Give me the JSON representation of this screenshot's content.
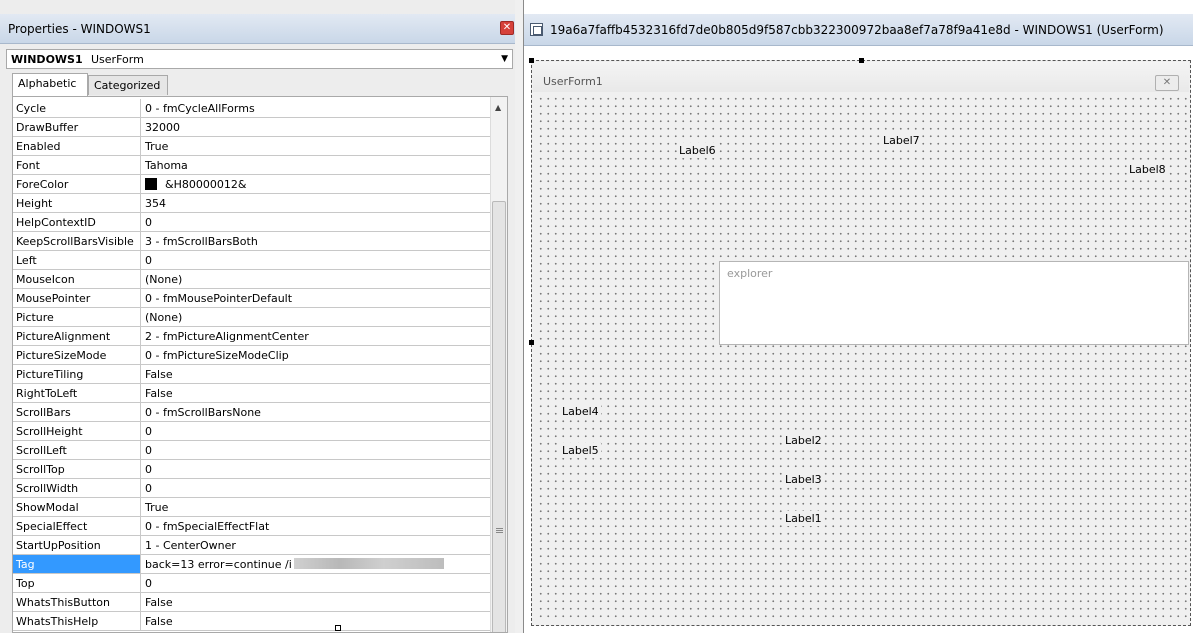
{
  "properties": {
    "title": "Properties - WINDOWS1",
    "close_glyph": "✕",
    "object": {
      "name": "WINDOWS1",
      "type": "UserForm"
    },
    "tabs": [
      "Alphabetic",
      "Categorized"
    ],
    "rows": [
      {
        "name": "Cycle",
        "value": "0 - fmCycleAllForms"
      },
      {
        "name": "DrawBuffer",
        "value": "32000"
      },
      {
        "name": "Enabled",
        "value": "True"
      },
      {
        "name": "Font",
        "value": "Tahoma"
      },
      {
        "name": "ForeColor",
        "value": "&H80000012&"
      },
      {
        "name": "Height",
        "value": "354"
      },
      {
        "name": "HelpContextID",
        "value": "0"
      },
      {
        "name": "KeepScrollBarsVisible",
        "value": "3 - fmScrollBarsBoth"
      },
      {
        "name": "Left",
        "value": "0"
      },
      {
        "name": "MouseIcon",
        "value": "(None)"
      },
      {
        "name": "MousePointer",
        "value": "0 - fmMousePointerDefault"
      },
      {
        "name": "Picture",
        "value": "(None)"
      },
      {
        "name": "PictureAlignment",
        "value": "2 - fmPictureAlignmentCenter"
      },
      {
        "name": "PictureSizeMode",
        "value": "0 - fmPictureSizeModeClip"
      },
      {
        "name": "PictureTiling",
        "value": "False"
      },
      {
        "name": "RightToLeft",
        "value": "False"
      },
      {
        "name": "ScrollBars",
        "value": "0 - fmScrollBarsNone"
      },
      {
        "name": "ScrollHeight",
        "value": "0"
      },
      {
        "name": "ScrollLeft",
        "value": "0"
      },
      {
        "name": "ScrollTop",
        "value": "0"
      },
      {
        "name": "ScrollWidth",
        "value": "0"
      },
      {
        "name": "ShowModal",
        "value": "True"
      },
      {
        "name": "SpecialEffect",
        "value": "0 - fmSpecialEffectFlat"
      },
      {
        "name": "StartUpPosition",
        "value": "1 - CenterOwner"
      },
      {
        "name": "Tag",
        "value": "back=13 error=continue /i",
        "value_end": "msi"
      },
      {
        "name": "Top",
        "value": "0"
      },
      {
        "name": "WhatsThisButton",
        "value": "False"
      },
      {
        "name": "WhatsThisHelp",
        "value": "False"
      }
    ],
    "selected_row": "Tag",
    "forecolor_swatch": "#000000",
    "selection_color": "#3399ff"
  },
  "designer": {
    "title": "19a6a7faffb4532316fd7de0b805d9f587cbb322300972baa8ef7a78f9a41e8d - WINDOWS1 (UserForm)",
    "form_caption": "UserForm1",
    "close_glyph": "✕",
    "labels": {
      "label6": "Label6",
      "label7": "Label7",
      "label8": "Label8",
      "label4": "Label4",
      "label5": "Label5",
      "label2": "Label2",
      "label3": "Label3",
      "label1": "Label1"
    },
    "textbox_text": "explorer"
  }
}
